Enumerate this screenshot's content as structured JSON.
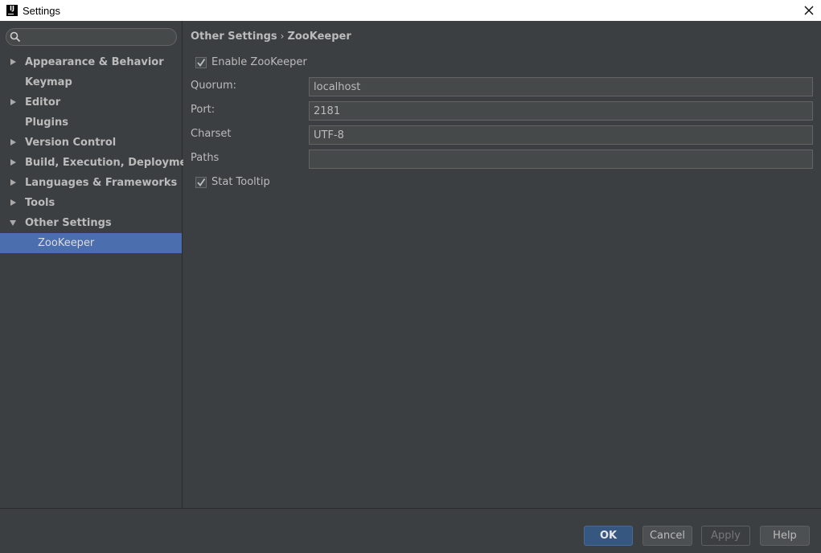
{
  "window": {
    "title": "Settings",
    "logo_text": "IJ"
  },
  "search": {
    "placeholder": "",
    "value": ""
  },
  "sidebar": {
    "items": [
      {
        "label": "Appearance & Behavior"
      },
      {
        "label": "Keymap"
      },
      {
        "label": "Editor"
      },
      {
        "label": "Plugins"
      },
      {
        "label": "Version Control"
      },
      {
        "label": "Build, Execution, Deployment"
      },
      {
        "label": "Languages & Frameworks"
      },
      {
        "label": "Tools"
      },
      {
        "label": "Other Settings"
      },
      {
        "label": "ZooKeeper"
      }
    ]
  },
  "breadcrumb": {
    "parent": "Other Settings",
    "separator": "›",
    "current": "ZooKeeper"
  },
  "form": {
    "enable": {
      "label": "Enable ZooKeeper",
      "checked": true
    },
    "quorum": {
      "label": "Quorum:",
      "value": "localhost"
    },
    "port": {
      "label": "Port:",
      "value": "2181"
    },
    "charset": {
      "label": "Charset",
      "value": "UTF-8"
    },
    "paths": {
      "label": "Paths",
      "value": ""
    },
    "stat_tooltip": {
      "label": "Stat Tooltip",
      "checked": true
    }
  },
  "buttons": {
    "ok": "OK",
    "cancel": "Cancel",
    "apply": "Apply",
    "help": "Help"
  },
  "colors": {
    "selection": "#4b6eaf",
    "background": "#3c3f41",
    "ok_button": "#365880"
  }
}
